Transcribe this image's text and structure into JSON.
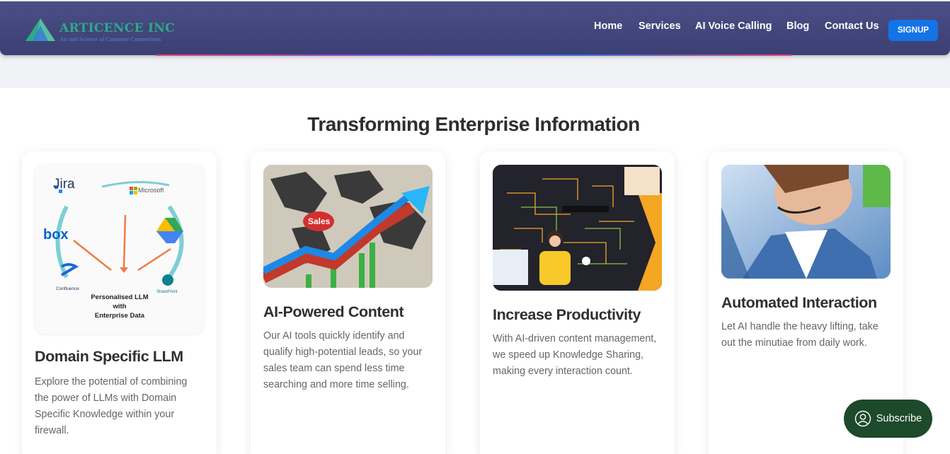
{
  "brand": {
    "name": "ARTICENCE INC",
    "tagline": "Art and Science of Customer Connections"
  },
  "nav": {
    "links": [
      "Home",
      "Services",
      "AI Voice Calling",
      "Blog",
      "Contact Us"
    ],
    "signup_label": "SIGNUP"
  },
  "section": {
    "title": "Transforming Enterprise Information"
  },
  "cards": [
    {
      "title": "Domain Specific LLM",
      "text": "Explore the potential of combining the power of LLMs with Domain Specific Knowledge within your firewall."
    },
    {
      "title": "AI-Powered Content",
      "text": "Our AI tools quickly identify and qualify high-potential leads, so your sales team can spend less time searching and more time selling."
    },
    {
      "title": "Increase Productivity",
      "text": "With AI-driven content management, we speed up Knowledge Sharing, making every interaction count."
    },
    {
      "title": "Automated Interaction",
      "text": "Let AI handle the heavy lifting, take out the minutiae from daily work."
    }
  ],
  "diagram": {
    "logos": [
      "Jira",
      "Microsoft",
      "box",
      "Confluence",
      "SharePoint"
    ],
    "center_label": [
      "Personalised LLM",
      "with",
      "Enterprise Data"
    ]
  },
  "sales_badge": "Sales",
  "subscribe_label": "Subscribe",
  "colors": {
    "nav_bg": "#3f437a",
    "brand_green": "#2fa889",
    "signup_blue": "#1473e6",
    "subscribe_bg": "#1d4a2a"
  }
}
